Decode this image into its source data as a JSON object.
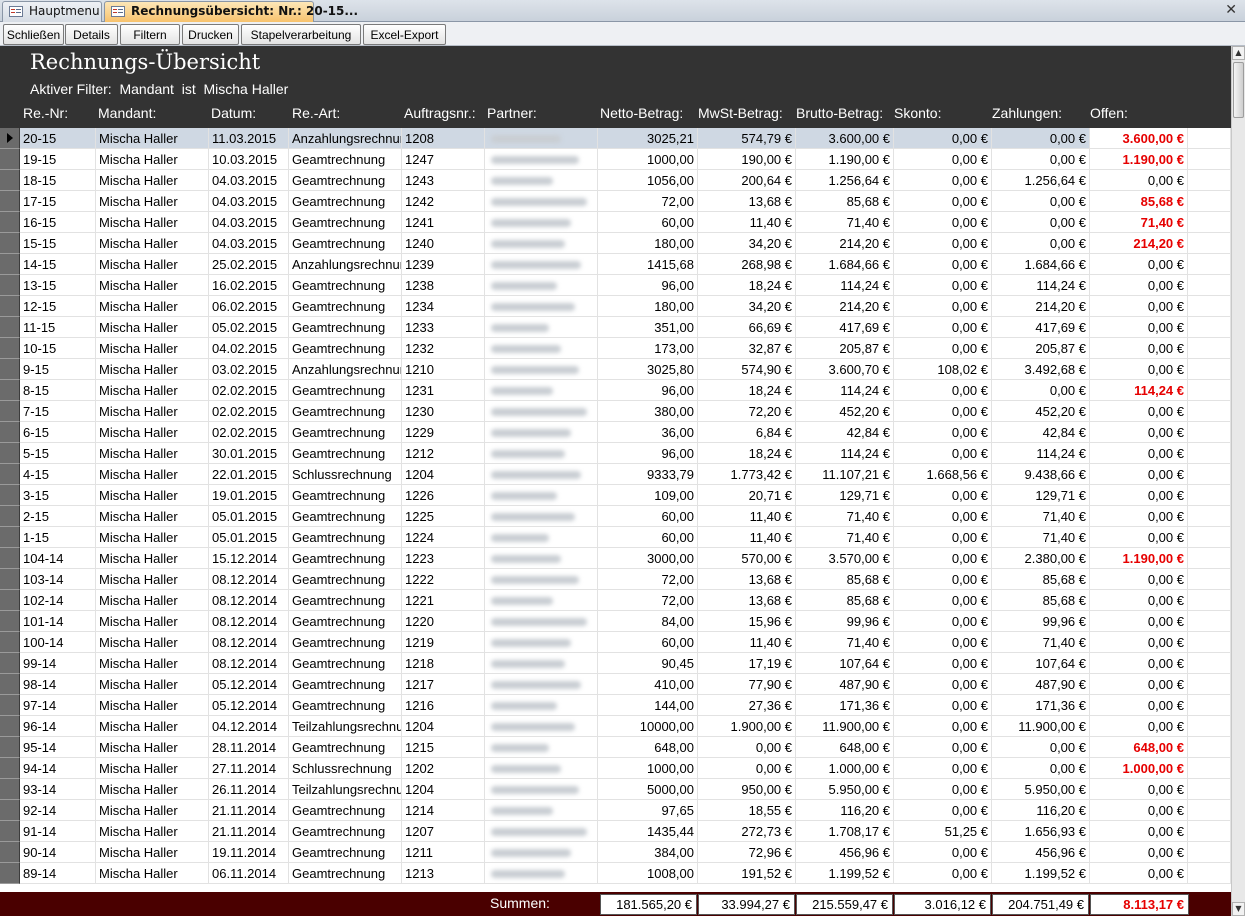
{
  "tabs": [
    {
      "label": "Hauptmenu",
      "active": false
    },
    {
      "label": "Rechnungsübersicht: Nr.: 20-15...",
      "active": true
    }
  ],
  "toolbar": {
    "buttons": [
      "Schließen",
      "Details",
      "Filtern",
      "Drucken",
      "Stapelverarbeitung",
      "Excel-Export"
    ]
  },
  "form": {
    "title": "Rechnungs-Übersicht",
    "filter_text": "Aktiver Filter:  Mandant  ist  Mischa Haller"
  },
  "columns": {
    "nr": "Re.-Nr:",
    "mandant": "Mandant:",
    "datum": "Datum:",
    "art": "Re.-Art:",
    "auftrag": "Auftragsnr.:",
    "partner": "Partner:",
    "netto": "Netto-Betrag:",
    "mwst": "MwSt-Betrag:",
    "brutto": "Brutto-Betrag:",
    "skonto": "Skonto:",
    "zahlungen": "Zahlungen:",
    "offen": "Offen:"
  },
  "rows": [
    {
      "nr": "20-15",
      "mandant": "Mischa Haller",
      "datum": "11.03.2015",
      "art": "Anzahlungsrechnung",
      "auftrag": "1208",
      "netto": "3025,21",
      "mwst": "574,79 €",
      "brutto": "3.600,00 €",
      "skonto": "0,00 €",
      "zahlungen": "0,00 €",
      "offen": "3.600,00 €",
      "open": true
    },
    {
      "nr": "19-15",
      "mandant": "Mischa Haller",
      "datum": "10.03.2015",
      "art": "Geamtrechnung",
      "auftrag": "1247",
      "netto": "1000,00",
      "mwst": "190,00 €",
      "brutto": "1.190,00 €",
      "skonto": "0,00 €",
      "zahlungen": "0,00 €",
      "offen": "1.190,00 €",
      "open": true
    },
    {
      "nr": "18-15",
      "mandant": "Mischa Haller",
      "datum": "04.03.2015",
      "art": "Geamtrechnung",
      "auftrag": "1243",
      "netto": "1056,00",
      "mwst": "200,64 €",
      "brutto": "1.256,64 €",
      "skonto": "0,00 €",
      "zahlungen": "1.256,64 €",
      "offen": "0,00 €",
      "open": false
    },
    {
      "nr": "17-15",
      "mandant": "Mischa Haller",
      "datum": "04.03.2015",
      "art": "Geamtrechnung",
      "auftrag": "1242",
      "netto": "72,00",
      "mwst": "13,68 €",
      "brutto": "85,68 €",
      "skonto": "0,00 €",
      "zahlungen": "0,00 €",
      "offen": "85,68 €",
      "open": true
    },
    {
      "nr": "16-15",
      "mandant": "Mischa Haller",
      "datum": "04.03.2015",
      "art": "Geamtrechnung",
      "auftrag": "1241",
      "netto": "60,00",
      "mwst": "11,40 €",
      "brutto": "71,40 €",
      "skonto": "0,00 €",
      "zahlungen": "0,00 €",
      "offen": "71,40 €",
      "open": true
    },
    {
      "nr": "15-15",
      "mandant": "Mischa Haller",
      "datum": "04.03.2015",
      "art": "Geamtrechnung",
      "auftrag": "1240",
      "netto": "180,00",
      "mwst": "34,20 €",
      "brutto": "214,20 €",
      "skonto": "0,00 €",
      "zahlungen": "0,00 €",
      "offen": "214,20 €",
      "open": true
    },
    {
      "nr": "14-15",
      "mandant": "Mischa Haller",
      "datum": "25.02.2015",
      "art": "Anzahlungsrechnung",
      "auftrag": "1239",
      "netto": "1415,68",
      "mwst": "268,98 €",
      "brutto": "1.684,66 €",
      "skonto": "0,00 €",
      "zahlungen": "1.684,66 €",
      "offen": "0,00 €",
      "open": false
    },
    {
      "nr": "13-15",
      "mandant": "Mischa Haller",
      "datum": "16.02.2015",
      "art": "Geamtrechnung",
      "auftrag": "1238",
      "netto": "96,00",
      "mwst": "18,24 €",
      "brutto": "114,24 €",
      "skonto": "0,00 €",
      "zahlungen": "114,24 €",
      "offen": "0,00 €",
      "open": false
    },
    {
      "nr": "12-15",
      "mandant": "Mischa Haller",
      "datum": "06.02.2015",
      "art": "Geamtrechnung",
      "auftrag": "1234",
      "netto": "180,00",
      "mwst": "34,20 €",
      "brutto": "214,20 €",
      "skonto": "0,00 €",
      "zahlungen": "214,20 €",
      "offen": "0,00 €",
      "open": false
    },
    {
      "nr": "11-15",
      "mandant": "Mischa Haller",
      "datum": "05.02.2015",
      "art": "Geamtrechnung",
      "auftrag": "1233",
      "netto": "351,00",
      "mwst": "66,69 €",
      "brutto": "417,69 €",
      "skonto": "0,00 €",
      "zahlungen": "417,69 €",
      "offen": "0,00 €",
      "open": false
    },
    {
      "nr": "10-15",
      "mandant": "Mischa Haller",
      "datum": "04.02.2015",
      "art": "Geamtrechnung",
      "auftrag": "1232",
      "netto": "173,00",
      "mwst": "32,87 €",
      "brutto": "205,87 €",
      "skonto": "0,00 €",
      "zahlungen": "205,87 €",
      "offen": "0,00 €",
      "open": false
    },
    {
      "nr": "9-15",
      "mandant": "Mischa Haller",
      "datum": "03.02.2015",
      "art": "Anzahlungsrechnung",
      "auftrag": "1210",
      "netto": "3025,80",
      "mwst": "574,90 €",
      "brutto": "3.600,70 €",
      "skonto": "108,02 €",
      "zahlungen": "3.492,68 €",
      "offen": "0,00 €",
      "open": false
    },
    {
      "nr": "8-15",
      "mandant": "Mischa Haller",
      "datum": "02.02.2015",
      "art": "Geamtrechnung",
      "auftrag": "1231",
      "netto": "96,00",
      "mwst": "18,24 €",
      "brutto": "114,24 €",
      "skonto": "0,00 €",
      "zahlungen": "0,00 €",
      "offen": "114,24 €",
      "open": true
    },
    {
      "nr": "7-15",
      "mandant": "Mischa Haller",
      "datum": "02.02.2015",
      "art": "Geamtrechnung",
      "auftrag": "1230",
      "netto": "380,00",
      "mwst": "72,20 €",
      "brutto": "452,20 €",
      "skonto": "0,00 €",
      "zahlungen": "452,20 €",
      "offen": "0,00 €",
      "open": false
    },
    {
      "nr": "6-15",
      "mandant": "Mischa Haller",
      "datum": "02.02.2015",
      "art": "Geamtrechnung",
      "auftrag": "1229",
      "netto": "36,00",
      "mwst": "6,84 €",
      "brutto": "42,84 €",
      "skonto": "0,00 €",
      "zahlungen": "42,84 €",
      "offen": "0,00 €",
      "open": false
    },
    {
      "nr": "5-15",
      "mandant": "Mischa Haller",
      "datum": "30.01.2015",
      "art": "Geamtrechnung",
      "auftrag": "1212",
      "netto": "96,00",
      "mwst": "18,24 €",
      "brutto": "114,24 €",
      "skonto": "0,00 €",
      "zahlungen": "114,24 €",
      "offen": "0,00 €",
      "open": false
    },
    {
      "nr": "4-15",
      "mandant": "Mischa Haller",
      "datum": "22.01.2015",
      "art": "Schlussrechnung",
      "auftrag": "1204",
      "netto": "9333,79",
      "mwst": "1.773,42 €",
      "brutto": "11.107,21 €",
      "skonto": "1.668,56 €",
      "zahlungen": "9.438,66 €",
      "offen": "0,00 €",
      "open": false
    },
    {
      "nr": "3-15",
      "mandant": "Mischa Haller",
      "datum": "19.01.2015",
      "art": "Geamtrechnung",
      "auftrag": "1226",
      "netto": "109,00",
      "mwst": "20,71 €",
      "brutto": "129,71 €",
      "skonto": "0,00 €",
      "zahlungen": "129,71 €",
      "offen": "0,00 €",
      "open": false
    },
    {
      "nr": "2-15",
      "mandant": "Mischa Haller",
      "datum": "05.01.2015",
      "art": "Geamtrechnung",
      "auftrag": "1225",
      "netto": "60,00",
      "mwst": "11,40 €",
      "brutto": "71,40 €",
      "skonto": "0,00 €",
      "zahlungen": "71,40 €",
      "offen": "0,00 €",
      "open": false
    },
    {
      "nr": "1-15",
      "mandant": "Mischa Haller",
      "datum": "05.01.2015",
      "art": "Geamtrechnung",
      "auftrag": "1224",
      "netto": "60,00",
      "mwst": "11,40 €",
      "brutto": "71,40 €",
      "skonto": "0,00 €",
      "zahlungen": "71,40 €",
      "offen": "0,00 €",
      "open": false
    },
    {
      "nr": "104-14",
      "mandant": "Mischa Haller",
      "datum": "15.12.2014",
      "art": "Geamtrechnung",
      "auftrag": "1223",
      "netto": "3000,00",
      "mwst": "570,00 €",
      "brutto": "3.570,00 €",
      "skonto": "0,00 €",
      "zahlungen": "2.380,00 €",
      "offen": "1.190,00 €",
      "open": true
    },
    {
      "nr": "103-14",
      "mandant": "Mischa Haller",
      "datum": "08.12.2014",
      "art": "Geamtrechnung",
      "auftrag": "1222",
      "netto": "72,00",
      "mwst": "13,68 €",
      "brutto": "85,68 €",
      "skonto": "0,00 €",
      "zahlungen": "85,68 €",
      "offen": "0,00 €",
      "open": false
    },
    {
      "nr": "102-14",
      "mandant": "Mischa Haller",
      "datum": "08.12.2014",
      "art": "Geamtrechnung",
      "auftrag": "1221",
      "netto": "72,00",
      "mwst": "13,68 €",
      "brutto": "85,68 €",
      "skonto": "0,00 €",
      "zahlungen": "85,68 €",
      "offen": "0,00 €",
      "open": false
    },
    {
      "nr": "101-14",
      "mandant": "Mischa Haller",
      "datum": "08.12.2014",
      "art": "Geamtrechnung",
      "auftrag": "1220",
      "netto": "84,00",
      "mwst": "15,96 €",
      "brutto": "99,96 €",
      "skonto": "0,00 €",
      "zahlungen": "99,96 €",
      "offen": "0,00 €",
      "open": false
    },
    {
      "nr": "100-14",
      "mandant": "Mischa Haller",
      "datum": "08.12.2014",
      "art": "Geamtrechnung",
      "auftrag": "1219",
      "netto": "60,00",
      "mwst": "11,40 €",
      "brutto": "71,40 €",
      "skonto": "0,00 €",
      "zahlungen": "71,40 €",
      "offen": "0,00 €",
      "open": false
    },
    {
      "nr": "99-14",
      "mandant": "Mischa Haller",
      "datum": "08.12.2014",
      "art": "Geamtrechnung",
      "auftrag": "1218",
      "netto": "90,45",
      "mwst": "17,19 €",
      "brutto": "107,64 €",
      "skonto": "0,00 €",
      "zahlungen": "107,64 €",
      "offen": "0,00 €",
      "open": false
    },
    {
      "nr": "98-14",
      "mandant": "Mischa Haller",
      "datum": "05.12.2014",
      "art": "Geamtrechnung",
      "auftrag": "1217",
      "netto": "410,00",
      "mwst": "77,90 €",
      "brutto": "487,90 €",
      "skonto": "0,00 €",
      "zahlungen": "487,90 €",
      "offen": "0,00 €",
      "open": false
    },
    {
      "nr": "97-14",
      "mandant": "Mischa Haller",
      "datum": "05.12.2014",
      "art": "Geamtrechnung",
      "auftrag": "1216",
      "netto": "144,00",
      "mwst": "27,36 €",
      "brutto": "171,36 €",
      "skonto": "0,00 €",
      "zahlungen": "171,36 €",
      "offen": "0,00 €",
      "open": false
    },
    {
      "nr": "96-14",
      "mandant": "Mischa Haller",
      "datum": "04.12.2014",
      "art": "Teilzahlungsrechnung",
      "auftrag": "1204",
      "netto": "10000,00",
      "mwst": "1.900,00 €",
      "brutto": "11.900,00 €",
      "skonto": "0,00 €",
      "zahlungen": "11.900,00 €",
      "offen": "0,00 €",
      "open": false
    },
    {
      "nr": "95-14",
      "mandant": "Mischa Haller",
      "datum": "28.11.2014",
      "art": "Geamtrechnung",
      "auftrag": "1215",
      "netto": "648,00",
      "mwst": "0,00 €",
      "brutto": "648,00 €",
      "skonto": "0,00 €",
      "zahlungen": "0,00 €",
      "offen": "648,00 €",
      "open": true
    },
    {
      "nr": "94-14",
      "mandant": "Mischa Haller",
      "datum": "27.11.2014",
      "art": "Schlussrechnung",
      "auftrag": "1202",
      "netto": "1000,00",
      "mwst": "0,00 €",
      "brutto": "1.000,00 €",
      "skonto": "0,00 €",
      "zahlungen": "0,00 €",
      "offen": "1.000,00 €",
      "open": true
    },
    {
      "nr": "93-14",
      "mandant": "Mischa Haller",
      "datum": "26.11.2014",
      "art": "Teilzahlungsrechnung",
      "auftrag": "1204",
      "netto": "5000,00",
      "mwst": "950,00 €",
      "brutto": "5.950,00 €",
      "skonto": "0,00 €",
      "zahlungen": "5.950,00 €",
      "offen": "0,00 €",
      "open": false
    },
    {
      "nr": "92-14",
      "mandant": "Mischa Haller",
      "datum": "21.11.2014",
      "art": "Geamtrechnung",
      "auftrag": "1214",
      "netto": "97,65",
      "mwst": "18,55 €",
      "brutto": "116,20 €",
      "skonto": "0,00 €",
      "zahlungen": "116,20 €",
      "offen": "0,00 €",
      "open": false
    },
    {
      "nr": "91-14",
      "mandant": "Mischa Haller",
      "datum": "21.11.2014",
      "art": "Geamtrechnung",
      "auftrag": "1207",
      "netto": "1435,44",
      "mwst": "272,73 €",
      "brutto": "1.708,17 €",
      "skonto": "51,25 €",
      "zahlungen": "1.656,93 €",
      "offen": "0,00 €",
      "open": false
    },
    {
      "nr": "90-14",
      "mandant": "Mischa Haller",
      "datum": "19.11.2014",
      "art": "Geamtrechnung",
      "auftrag": "1211",
      "netto": "384,00",
      "mwst": "72,96 €",
      "brutto": "456,96 €",
      "skonto": "0,00 €",
      "zahlungen": "456,96 €",
      "offen": "0,00 €",
      "open": false
    },
    {
      "nr": "89-14",
      "mandant": "Mischa Haller",
      "datum": "06.11.2014",
      "art": "Geamtrechnung",
      "auftrag": "1213",
      "netto": "1008,00",
      "mwst": "191,52 €",
      "brutto": "1.199,52 €",
      "skonto": "0,00 €",
      "zahlungen": "1.199,52 €",
      "offen": "0,00 €",
      "open": false
    }
  ],
  "footer": {
    "label": "Summen:",
    "netto": "181.565,20 €",
    "mwst": "33.994,27 €",
    "brutto": "215.559,47 €",
    "skonto": "3.016,12 €",
    "zahlungen": "204.751,49 €",
    "offen": "8.113,17 €"
  },
  "colors": {
    "header_bg": "#333333",
    "footer_bg": "#4a0000",
    "open_amount": "#e60000",
    "current_row": "#cfd8e3"
  }
}
